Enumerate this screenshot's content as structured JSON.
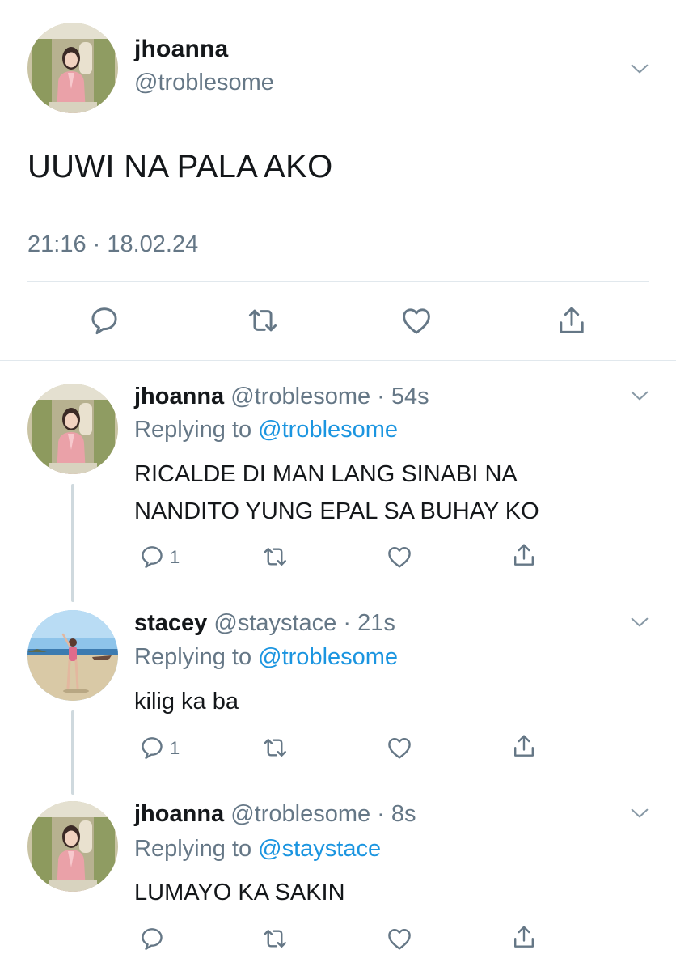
{
  "main_tweet": {
    "author_name": "jhoanna",
    "author_handle": "@troblesome",
    "text": "UUWI NA PALA AKO",
    "timestamp": "21:16 · 18.02.24"
  },
  "replies": [
    {
      "author_name": "jhoanna",
      "handle_time": "@troblesome · 54s",
      "replying_prefix": "Replying to ",
      "replying_to": "@troblesome",
      "text": "RICALDE DI MAN LANG SINABI NA NANDITO YUNG EPAL SA BUHAY KO",
      "reply_count": "1"
    },
    {
      "author_name": "stacey",
      "handle_time": "@staystace · 21s",
      "replying_prefix": "Replying to ",
      "replying_to": "@troblesome",
      "text": "kilig ka ba",
      "reply_count": "1"
    },
    {
      "author_name": "jhoanna",
      "handle_time": "@troblesome · 8s",
      "replying_prefix": "Replying to ",
      "replying_to": "@staystace",
      "text": "LUMAYO KA SAKIN",
      "reply_count": ""
    }
  ],
  "icons": [
    "reply-icon",
    "retweet-icon",
    "like-icon",
    "share-icon",
    "chevron-down-icon"
  ],
  "colors": {
    "text_primary": "#14171a",
    "text_secondary": "#657786",
    "mention": "#1b95e0",
    "divider": "#e1e8ed",
    "thread_line": "#cfd9de"
  }
}
